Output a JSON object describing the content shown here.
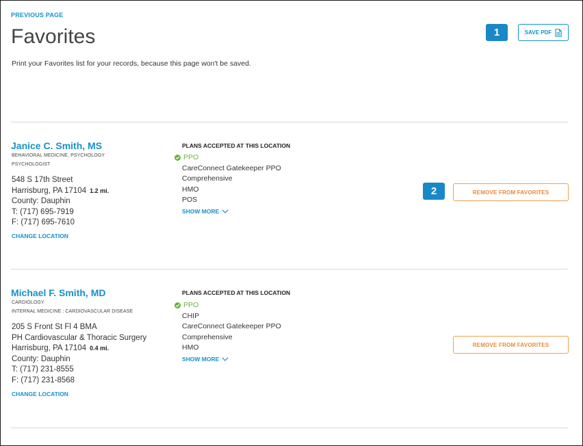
{
  "header": {
    "previous_page": "PREVIOUS PAGE",
    "title": "Favorites",
    "subtitle": "Print your Favorites list for your records, because this page won't be saved.",
    "save_pdf_label": "SAVE PDF"
  },
  "callouts": [
    "1",
    "2"
  ],
  "providers": [
    {
      "name": "Janice C. Smith, MS",
      "specialties": [
        "BEHAVIORAL MEDICINE, PSYCHOLOGY",
        "PSYCHOLOGIST"
      ],
      "address": [
        "548 S 17th Street"
      ],
      "city_line": "Harrisburg, PA 17104",
      "distance": "1.2 mi.",
      "county": "County: Dauphin",
      "phone": "T: (717) 695-7919",
      "fax": "F: (717) 695-7610",
      "change_location": "CHANGE LOCATION",
      "plans_heading": "PLANS ACCEPTED AT THIS LOCATION",
      "plan_ppo": "PPO",
      "plans": [
        "CareConnect Gatekeeper PPO",
        "Comprehensive",
        "HMO",
        "POS"
      ],
      "show_more": "SHOW MORE",
      "remove_label": "REMOVE FROM FAVORITES"
    },
    {
      "name": "Michael F. Smith, MD",
      "specialties": [
        "CARDIOLOGY",
        "INTERNAL MEDICINE : CARDIOVASCULAR DISEASE"
      ],
      "address": [
        "205 S Front St Fl 4 BMA",
        "PH Cardiovascular & Thoracic Surgery"
      ],
      "city_line": "Harrisburg, PA 17104",
      "distance": "0.4 mi.",
      "county": "County: Dauphin",
      "phone": "T: (717) 231-8555",
      "fax": "F: (717) 231-8568",
      "change_location": "CHANGE LOCATION",
      "plans_heading": "PLANS ACCEPTED AT THIS LOCATION",
      "plan_ppo": "PPO",
      "plans": [
        "CHIP",
        "CareConnect Gatekeeper PPO",
        "Comprehensive",
        "HMO"
      ],
      "show_more": "SHOW MORE",
      "remove_label": "REMOVE FROM FAVORITES"
    }
  ]
}
